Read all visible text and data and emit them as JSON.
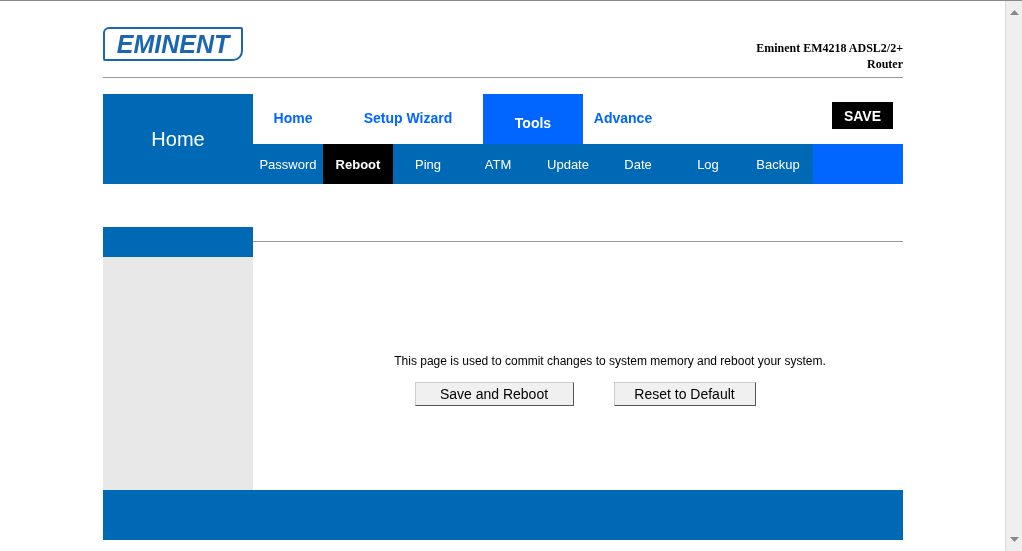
{
  "header": {
    "logo": "EMINENT",
    "title_lines": [
      "Eminent EM4218 ADSL2/2+",
      "Router"
    ]
  },
  "section_label": "Home",
  "tabs": [
    {
      "label": "Home",
      "selected": false
    },
    {
      "label": "Setup Wizard",
      "selected": false
    },
    {
      "label": "Tools",
      "selected": true
    },
    {
      "label": "Advance",
      "selected": false
    }
  ],
  "save_button": "SAVE",
  "subtabs": [
    {
      "label": "Password",
      "selected": false
    },
    {
      "label": "Reboot",
      "selected": true
    },
    {
      "label": "Ping",
      "selected": false
    },
    {
      "label": "ATM",
      "selected": false
    },
    {
      "label": "Update",
      "selected": false
    },
    {
      "label": "Date",
      "selected": false
    },
    {
      "label": "Log",
      "selected": false
    },
    {
      "label": "Backup",
      "selected": false
    }
  ],
  "content": {
    "description": "This page is used to commit changes to system memory and reboot your system.",
    "buttons": [
      "Save and Reboot",
      "Reset to Default"
    ]
  }
}
